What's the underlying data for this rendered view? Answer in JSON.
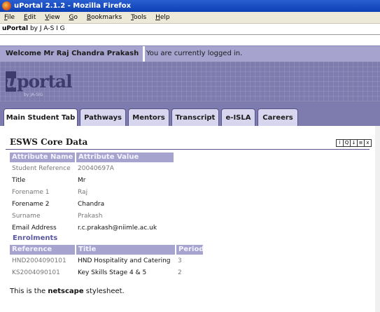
{
  "window": {
    "title": "uPortal 2.1.2 - Mozilla Firefox"
  },
  "menu": [
    "File",
    "Edit",
    "View",
    "Go",
    "Bookmarks",
    "Tools",
    "Help"
  ],
  "brand": {
    "name": "uPortal",
    "by": "by J A-S I G"
  },
  "welcome": {
    "greeting": "Welcome Mr Raj Chandra Prakash",
    "status": "You are currently logged in."
  },
  "logo": {
    "text": "portal",
    "letter": "u",
    "byline": "by JA-SIG"
  },
  "tabs": [
    "Main Student Tab",
    "Pathways",
    "Mentors",
    "Transcript",
    "e-ISLA",
    "Careers"
  ],
  "channel": {
    "title": "ESWS Core Data",
    "controls": [
      "about",
      "zoom",
      "download",
      "edit",
      "close"
    ]
  },
  "attributes": {
    "headers": [
      "Attribute Name",
      "Attribute Value"
    ],
    "rows": [
      [
        "Student Reference",
        "20040697A"
      ],
      [
        "Title",
        "Mr"
      ],
      [
        "Forename 1",
        "Raj"
      ],
      [
        "Forename 2",
        "Chandra"
      ],
      [
        "Surname",
        "Prakash"
      ],
      [
        "Email Address",
        "r.c.prakash@niimle.ac.uk"
      ]
    ]
  },
  "enrolments": {
    "label": "Enrolments",
    "headers": [
      "Reference",
      "Title",
      "Period"
    ],
    "rows": [
      [
        "HND2004090101",
        "HND Hospitality and Catering",
        "3"
      ],
      [
        "KS2004090101",
        "Key Skills Stage 4 & 5",
        "2"
      ]
    ]
  },
  "note": {
    "before": "This is the ",
    "bold": "netscape",
    "after": " stylesheet."
  }
}
